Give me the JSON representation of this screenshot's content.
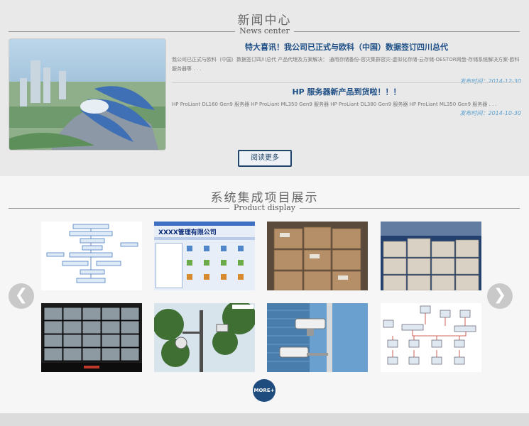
{
  "news": {
    "title": "新闻中心",
    "subtitle": "News center",
    "items": [
      {
        "headline": "特大喜讯！我公司已正式与欧科（中国）数据签订四川总代",
        "desc": "我公司已正式与欧科（中国）数据签订四川总代 产品代理及方案解决： 通用存储备份-容灾集群容灾-虚拟化存储-云存储-OESTOR网盘-存储系统解决方案-欧科服务器等 . . .",
        "date": "发布时间：2014-12-30"
      },
      {
        "headline": "HP 服务器新产品到货啦！！！",
        "desc": "HP ProLiant DL160 Gen9 服务器 HP ProLiant ML350 Gen9 服务器 HP ProLiant DL380 Gen9 服务器 HP ProLiant ML350 Gen9 服务器 . . .",
        "date": "发布时间：2014-10-30"
      }
    ],
    "read_more": "阅读更多",
    "image_icon": "architecture-photo"
  },
  "product": {
    "title": "系统集成项目展示",
    "subtitle": "Product display",
    "prev_glyph": "❮",
    "next_glyph": "❯",
    "more_label": "MORE+",
    "thumb2_label": "XXXX管理有限公司",
    "thumbs": [
      {
        "icon": "flowchart-diagram"
      },
      {
        "icon": "management-software-screenshot"
      },
      {
        "icon": "server-boxes-photo"
      },
      {
        "icon": "server-boxes-stack-photo"
      },
      {
        "icon": "video-wall-monitor-room"
      },
      {
        "icon": "street-camera-pole"
      },
      {
        "icon": "cctv-camera-building"
      },
      {
        "icon": "network-topology-diagram"
      }
    ]
  },
  "colors": {
    "accent": "#1e4c7e",
    "headline": "#1d4e85",
    "date": "#5aa0d0"
  }
}
